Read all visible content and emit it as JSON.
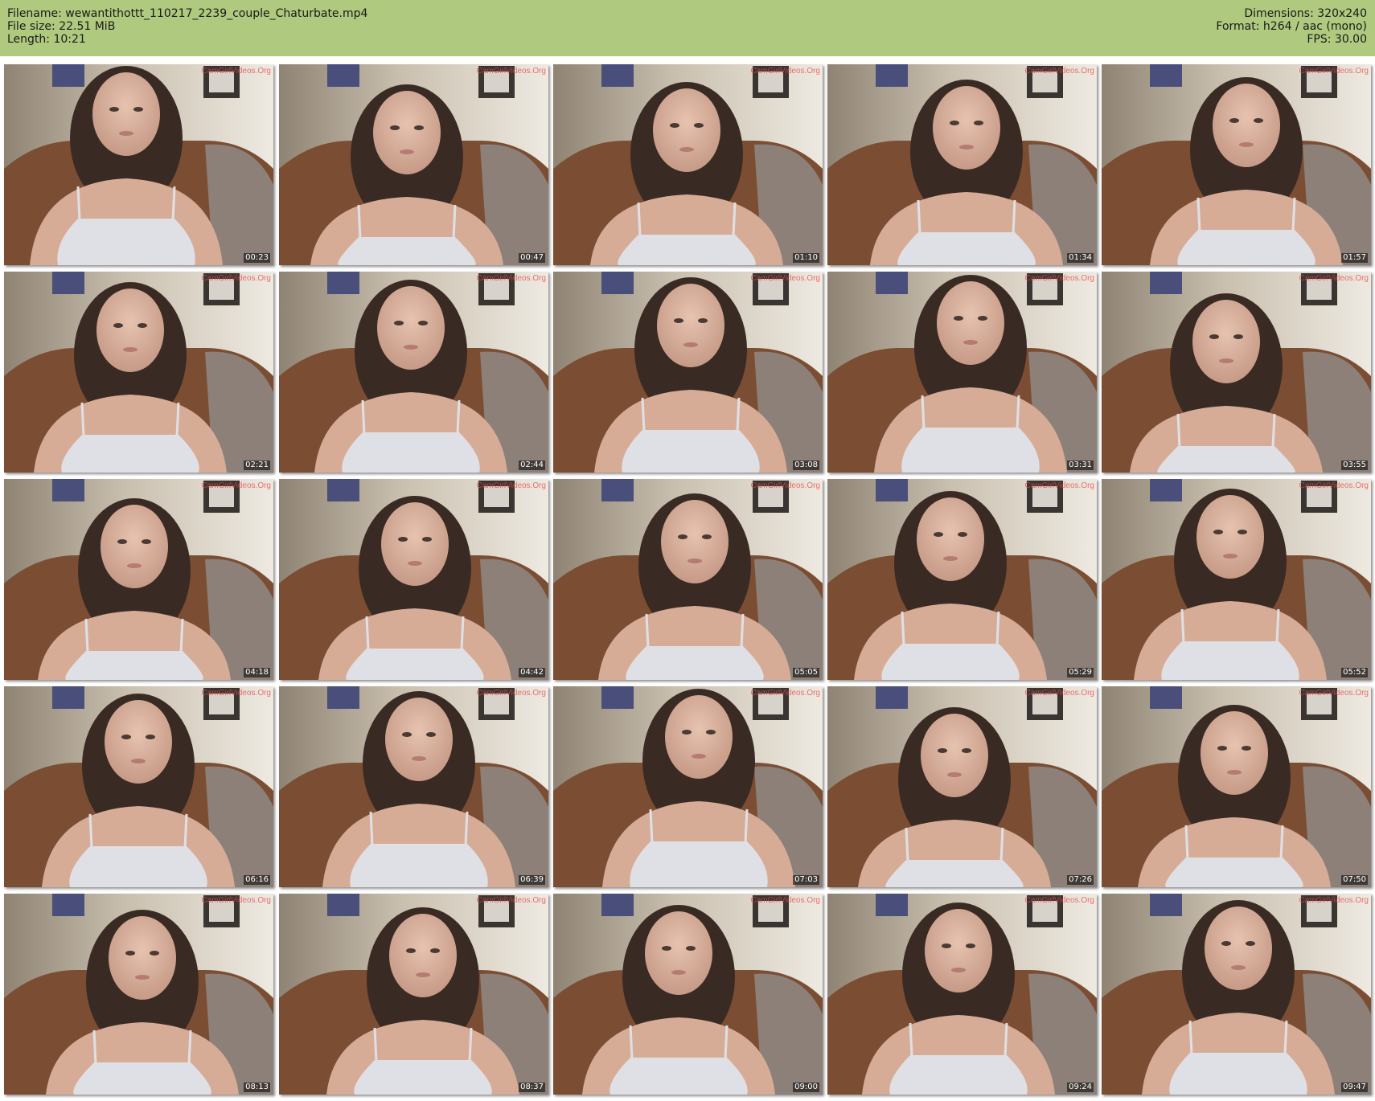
{
  "header": {
    "filename": "Filename: wewantithottt_110217_2239_couple_Chaturbate.mp4",
    "filesize": "File size: 22.51 MiB",
    "length": "Length: 10:21",
    "dimensions": "Dimensions: 320x240",
    "format": "Format: h264 / aac (mono)",
    "fps": "FPS: 30.00"
  },
  "watermark_logo": "CamGirlVideos.Org",
  "colors": {
    "header_bg": "#afc97e",
    "page_bg": "#ffffff"
  },
  "thumbnails": [
    {
      "timestamp": "00:23"
    },
    {
      "timestamp": "00:47"
    },
    {
      "timestamp": "01:10"
    },
    {
      "timestamp": "01:34"
    },
    {
      "timestamp": "01:57"
    },
    {
      "timestamp": "02:21"
    },
    {
      "timestamp": "02:44"
    },
    {
      "timestamp": "03:08"
    },
    {
      "timestamp": "03:31"
    },
    {
      "timestamp": "03:55"
    },
    {
      "timestamp": "04:18"
    },
    {
      "timestamp": "04:42"
    },
    {
      "timestamp": "05:05"
    },
    {
      "timestamp": "05:29"
    },
    {
      "timestamp": "05:52"
    },
    {
      "timestamp": "06:16"
    },
    {
      "timestamp": "06:39"
    },
    {
      "timestamp": "07:03"
    },
    {
      "timestamp": "07:26"
    },
    {
      "timestamp": "07:50"
    },
    {
      "timestamp": "08:13"
    },
    {
      "timestamp": "08:37"
    },
    {
      "timestamp": "09:00"
    },
    {
      "timestamp": "09:24"
    },
    {
      "timestamp": "09:47"
    }
  ]
}
